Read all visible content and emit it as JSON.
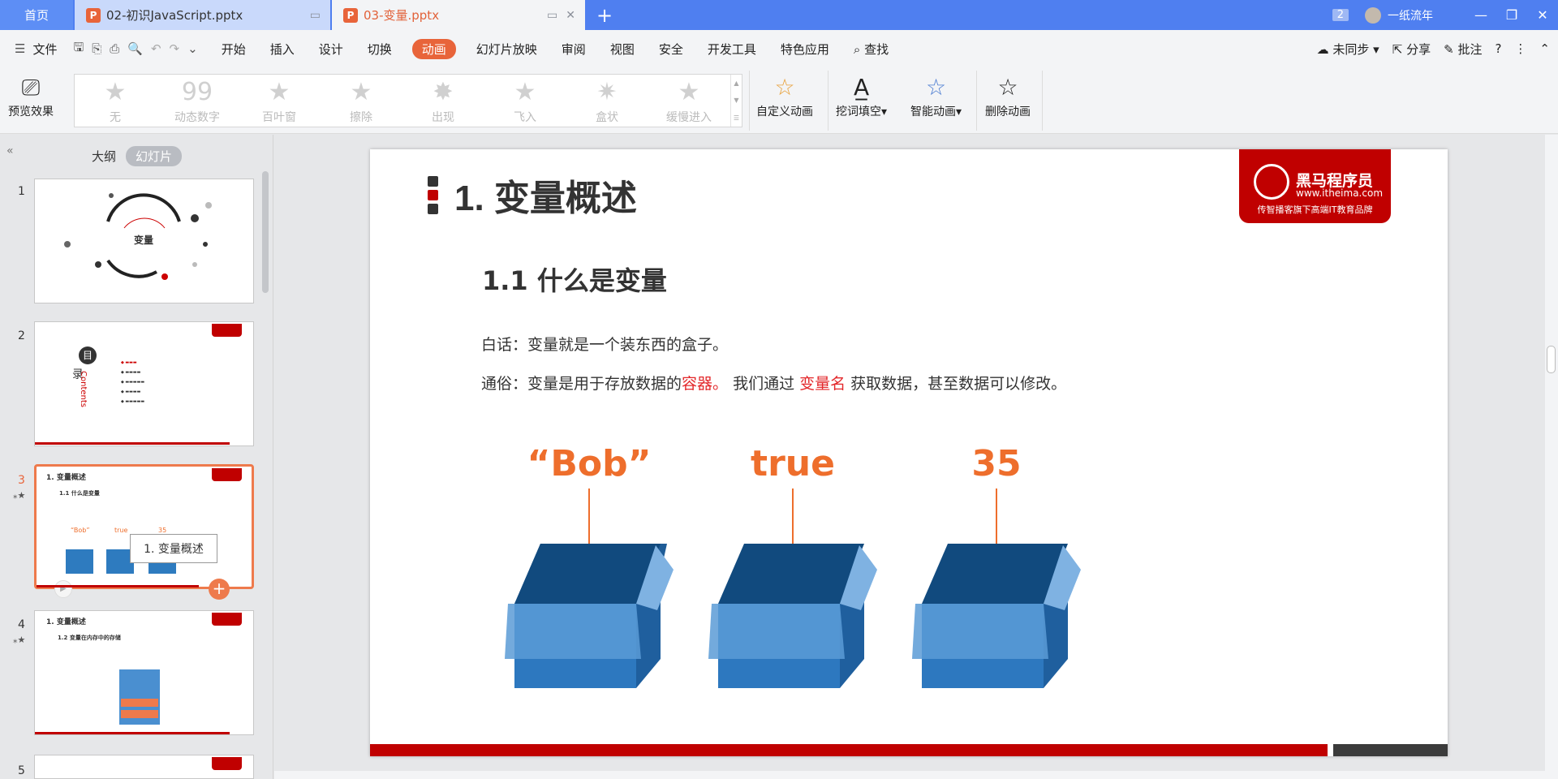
{
  "titlebar": {
    "home_tab": "首页",
    "tabs": [
      {
        "label": "02-初识JavaScript.pptx"
      },
      {
        "label": "03-变量.pptx"
      }
    ],
    "notification_count": "2",
    "user_name": "一纸流年"
  },
  "menubar": {
    "file_label": "文件",
    "items": [
      "开始",
      "插入",
      "设计",
      "切换",
      "动画",
      "幻灯片放映",
      "审阅",
      "视图",
      "安全",
      "开发工具",
      "特色应用"
    ],
    "active_item": "动画",
    "search_label": "查找",
    "sync_label": "未同步",
    "share_label": "分享",
    "comment_label": "批注"
  },
  "ribbon": {
    "preview_label": "预览效果",
    "gallery": [
      "无",
      "动态数字",
      "百叶窗",
      "擦除",
      "出现",
      "飞入",
      "盒状",
      "缓慢进入"
    ],
    "custom_animation": "自定义动画",
    "cloze_label": "挖词填空",
    "smart_animation": "智能动画",
    "delete_animation": "删除动画"
  },
  "sidebar": {
    "tab_outline": "大纲",
    "tab_slides": "幻灯片",
    "slide_numbers": [
      "1",
      "2",
      "3",
      "4",
      "5"
    ],
    "selected_slide": 3,
    "tooltip": "1. 变量概述",
    "thumb1_title": "变量",
    "thumb2_toc_char1": "目",
    "thumb2_toc_char2": "录",
    "thumb2_contents": "Contents",
    "thumb3_title": "1. 变量概述",
    "thumb3_sub": "1.1 什么是变量",
    "thumb4_title": "1. 变量概述",
    "thumb4_sub": "1.2 变量在内存中的存储"
  },
  "slide": {
    "title": "1. 变量概述",
    "logo_name": "黑马程序员",
    "logo_url": "www.itheima.com",
    "logo_slogan": "传智播客旗下高端IT教育品牌",
    "subtitle": "1.1 什么是变量",
    "line1": "白话：变量就是一个装东西的盒子。",
    "line2_a": "通俗：变量是用于存放数据的",
    "line2_b": "容器。",
    "line2_c": " 我们通过 ",
    "line2_d": "变量名",
    "line2_e": " 获取数据，甚至数据可以修改。",
    "boxes": [
      "“Bob”",
      "true",
      "35"
    ],
    "colors": {
      "accent": "#c00000",
      "label": "#ee6e2c",
      "box": "#2e7bbf"
    }
  }
}
